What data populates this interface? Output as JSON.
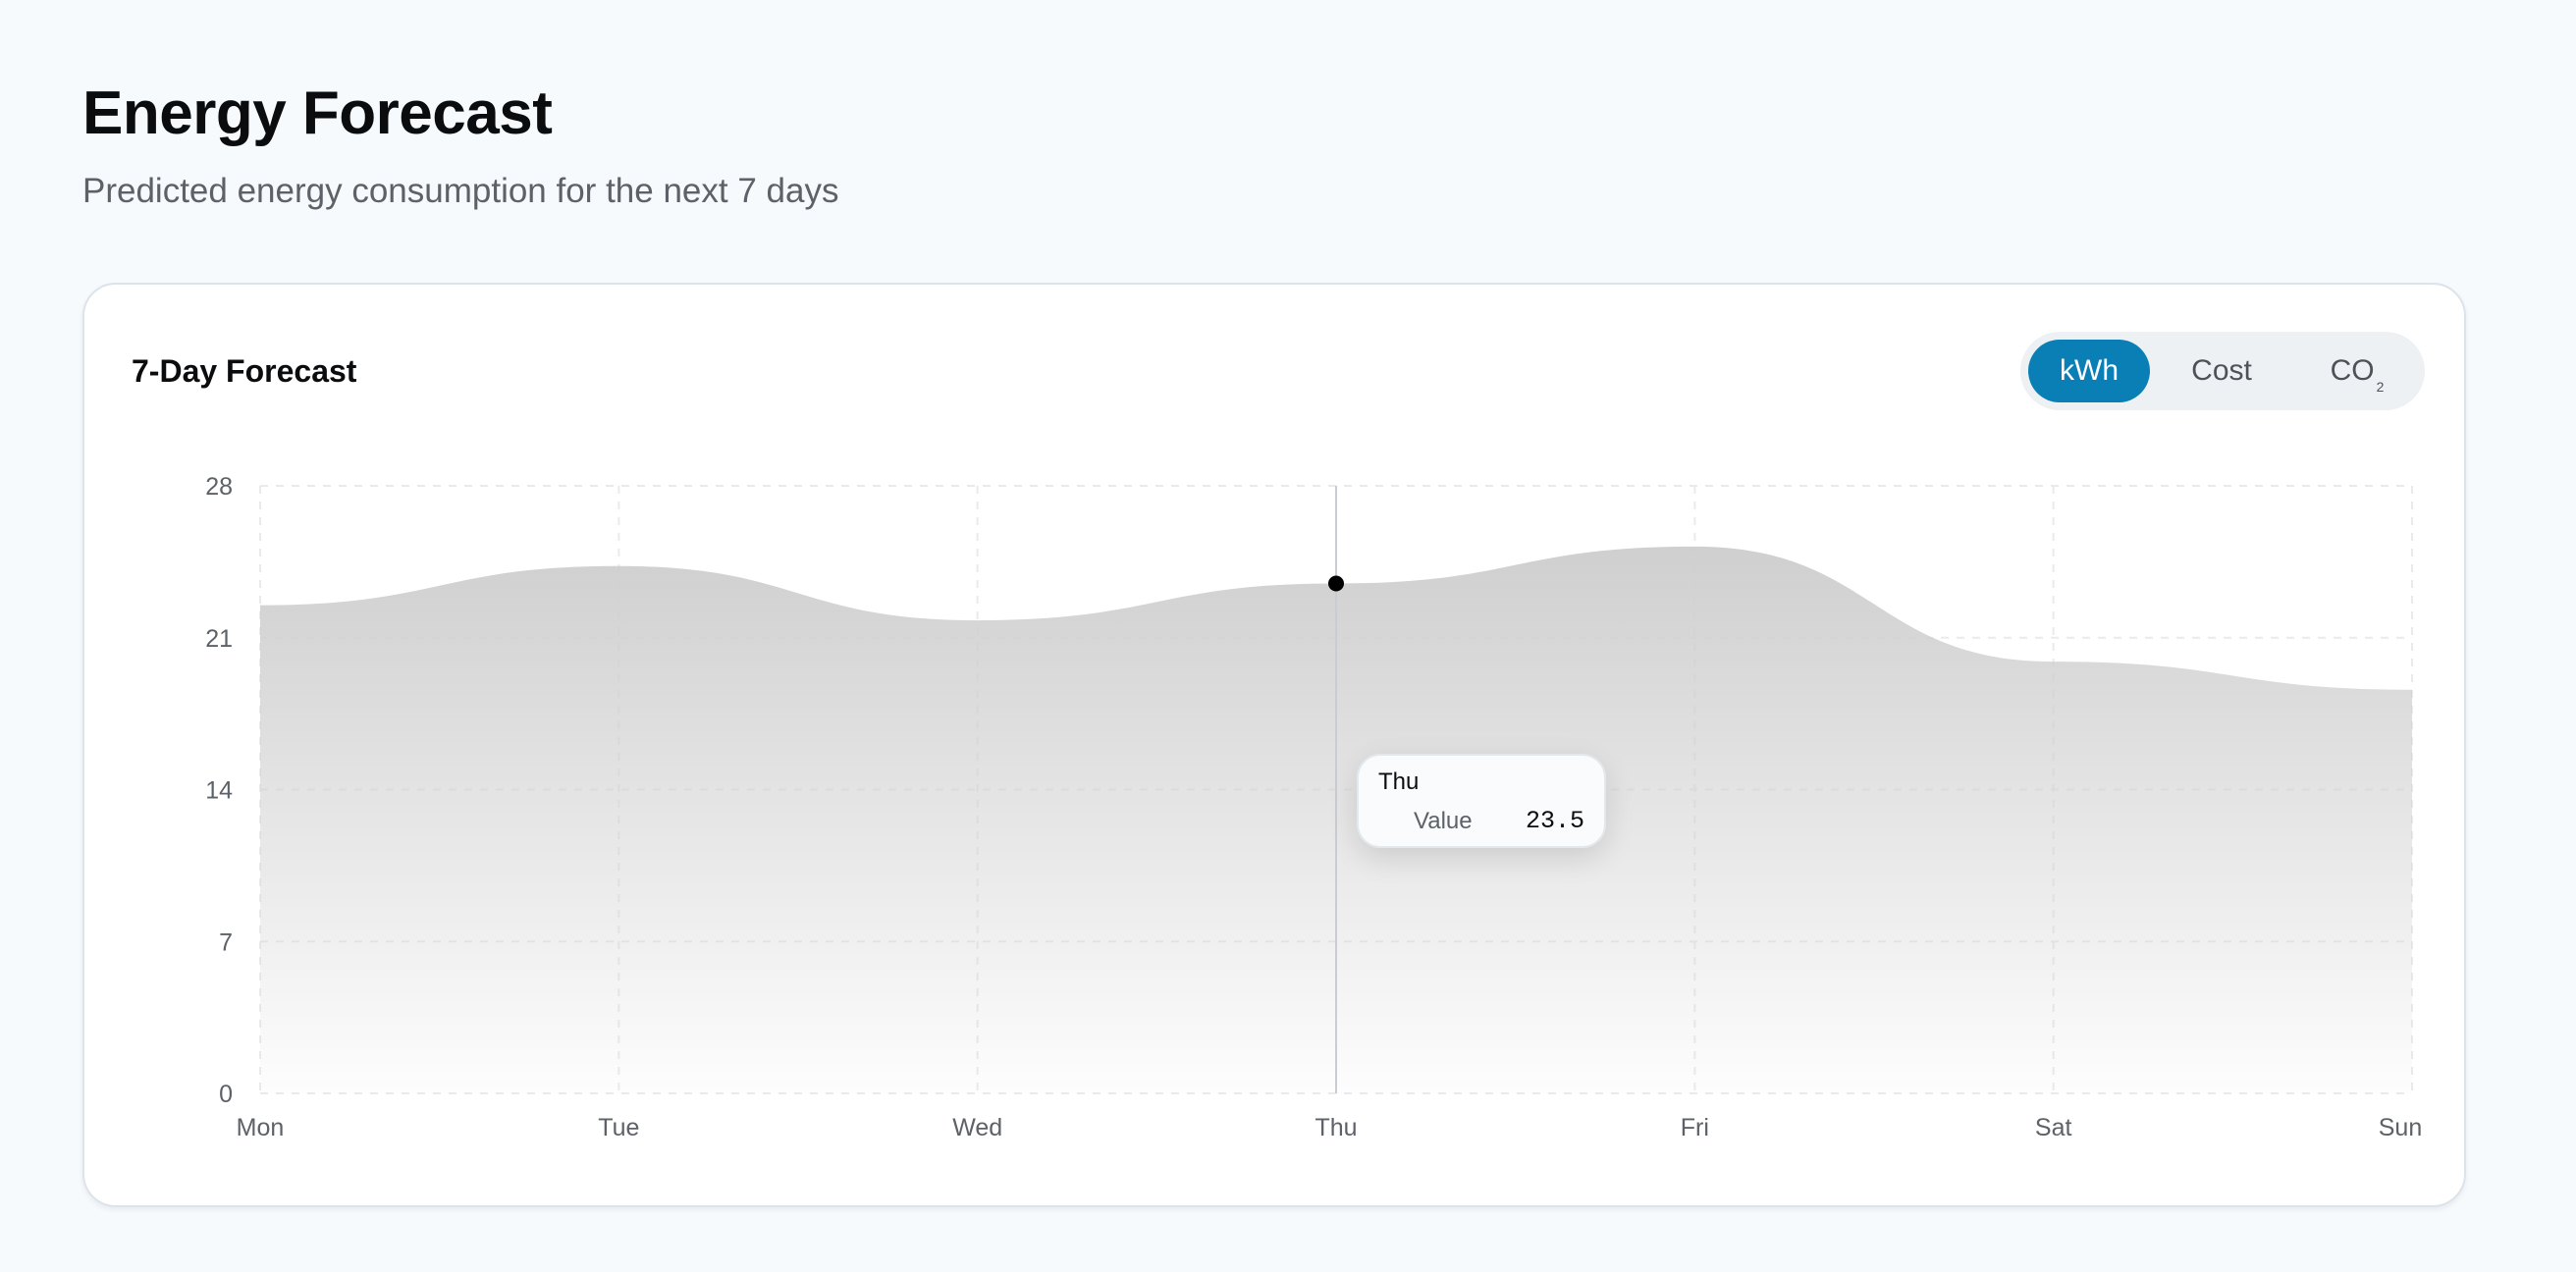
{
  "header": {
    "title": "Energy Forecast",
    "subtitle": "Predicted energy consumption for the next 7 days"
  },
  "card": {
    "title": "7-Day Forecast",
    "toggle": {
      "options": [
        {
          "label": "kWh",
          "active": true
        },
        {
          "label": "Cost",
          "active": false
        },
        {
          "label": "CO",
          "sub": "2",
          "active": false
        }
      ],
      "active_color": "#0a7fb6"
    }
  },
  "tooltip": {
    "label": "Thu",
    "series": "Value",
    "value": "23.5"
  },
  "chart_data": {
    "type": "area",
    "categories": [
      "Mon",
      "Tue",
      "Wed",
      "Thu",
      "Fri",
      "Sat",
      "Sun"
    ],
    "series": [
      {
        "values": [
          22.5,
          24.3,
          21.8,
          23.5,
          25.2,
          19.9,
          18.6
        ]
      }
    ],
    "yticks": [
      0,
      7,
      14,
      21,
      28
    ],
    "ylim": [
      0,
      28
    ],
    "grid": true,
    "highlight_index": 3,
    "fill_color": "#cfcfcf",
    "title": "",
    "xlabel": "",
    "ylabel": ""
  }
}
